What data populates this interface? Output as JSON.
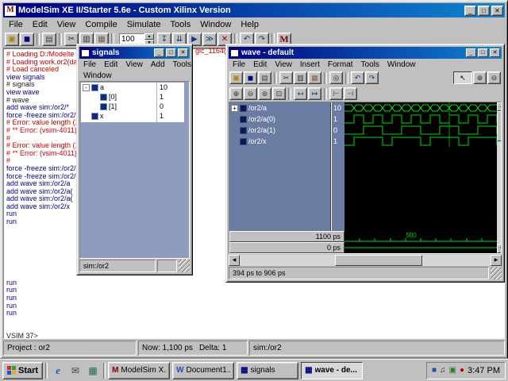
{
  "colors": {
    "title_gradient_start": "#000080",
    "title_gradient_end": "#1084d0",
    "error_text": "#cc0000",
    "command_text": "#00008b",
    "trace_green": "#00dd00",
    "signals_pane_slate": "#8e9cc0",
    "wave_names_bg": "#6b7ca2",
    "wave_bg": "#000000"
  },
  "window_controls": {
    "min": "_",
    "max": "□",
    "close": "✕"
  },
  "scrollbar": {
    "up": "▲",
    "down": "▼",
    "left": "◀",
    "right": "▶"
  },
  "main_window": {
    "title": "ModelSim XE II/Starter 5.6e - Custom Xilinx Version",
    "icon_letter": "M",
    "menu": [
      "File",
      "Edit",
      "View",
      "Compile",
      "Simulate",
      "Tools",
      "Window",
      "Help"
    ],
    "toolbar_left": [
      {
        "glyph": "▣",
        "color": "#b08000",
        "name": "open-icon"
      },
      {
        "glyph": "◼",
        "color": "#000080",
        "name": "save-icon"
      },
      {
        "cls": "sep",
        "inter": false
      },
      {
        "glyph": "▤",
        "color": "#404040",
        "name": "print-icon"
      },
      {
        "cls": "sep",
        "inter": false
      },
      {
        "glyph": "✂",
        "color": "#303030",
        "name": "cut-icon"
      },
      {
        "glyph": "▥",
        "color": "#303030",
        "name": "copy-icon"
      },
      {
        "glyph": "▦",
        "color": "#806040",
        "name": "paste-icon"
      },
      {
        "cls": "sep",
        "inter": false
      }
    ],
    "run_length": "100",
    "spin_up": "▲",
    "spin_down": "▼",
    "toolbar_right": [
      {
        "glyph": "↧",
        "color": "#004080",
        "name": "step-icon"
      },
      {
        "glyph": "⇊",
        "color": "#004080",
        "name": "step-over-icon"
      },
      {
        "glyph": "▶",
        "color": "#004080",
        "name": "run-icon"
      },
      {
        "glyph": "≫",
        "color": "#004080",
        "name": "continue-run-icon"
      },
      {
        "glyph": "✕",
        "color": "#a00000",
        "name": "break-icon"
      },
      {
        "cls": "sep",
        "inter": false
      },
      {
        "glyph": "↶",
        "color": "#004080",
        "name": "undo-icon"
      },
      {
        "glyph": "↷",
        "color": "#004080",
        "name": "redo-icon"
      },
      {
        "cls": "sep",
        "inter": false
      },
      {
        "glyph": "M",
        "color": "#800000",
        "name": "modelsim-logo-icon",
        "cls": "logo"
      }
    ],
    "status": {
      "project": "Project : or2",
      "now": "Now: 1,100 ps",
      "delta": "Delta: 1",
      "context": "sim:/or2"
    }
  },
  "transcript": {
    "overflow_fragment": "gic_1164(b",
    "lines": [
      {
        "t": "# Loading D:/Modelte",
        "cls": "c-red"
      },
      {
        "t": "# Loading work.or2(da",
        "cls": "c-red"
      },
      {
        "t": "# Load canceled",
        "cls": "c-red"
      },
      {
        "t": "view signals",
        "cls": "c-blue"
      },
      {
        "t": "# signals",
        "cls": "c-blk"
      },
      {
        "t": "view wave",
        "cls": "c-blue"
      },
      {
        "t": "# wave",
        "cls": "c-blk"
      },
      {
        "t": "add wave sim:/or2/*",
        "cls": "c-blue"
      },
      {
        "t": "force -freeze sim:/or2/*",
        "cls": "c-blue"
      },
      {
        "t": "# Error: value length (1",
        "cls": "c-red"
      },
      {
        "t": "# ** Error: (vsim-4011)",
        "cls": "c-red"
      },
      {
        "t": "#",
        "cls": "c-red"
      },
      {
        "t": "# Error: value length (1",
        "cls": "c-red"
      },
      {
        "t": "# ** Error: (vsim-4011)",
        "cls": "c-red"
      },
      {
        "t": "#",
        "cls": "c-red"
      },
      {
        "t": "force -freeze sim:/or2/",
        "cls": "c-blue"
      },
      {
        "t": "force -freeze sim:/or2/",
        "cls": "c-blue"
      },
      {
        "t": "add wave sim:/or2/a",
        "cls": "c-blue"
      },
      {
        "t": "add wave sim:/or2/a(",
        "cls": "c-blue"
      },
      {
        "t": "add wave sim:/or2/a(",
        "cls": "c-blue"
      },
      {
        "t": "add wave sim:/or2/x",
        "cls": "c-blue"
      },
      {
        "t": "run",
        "cls": "c-blue"
      },
      {
        "t": "run",
        "cls": "c-blue"
      },
      {
        "t": "",
        "cls": "c-blk"
      },
      {
        "t": "",
        "cls": "c-blk"
      },
      {
        "t": "",
        "cls": "c-blk"
      },
      {
        "t": "",
        "cls": "c-blk"
      },
      {
        "t": "",
        "cls": "c-blk"
      },
      {
        "t": "",
        "cls": "c-blk"
      },
      {
        "t": "",
        "cls": "c-blk"
      },
      {
        "t": "run",
        "cls": "c-blue"
      },
      {
        "t": "run",
        "cls": "c-blue"
      },
      {
        "t": "run",
        "cls": "c-blue"
      },
      {
        "t": "run",
        "cls": "c-blue"
      },
      {
        "t": "run",
        "cls": "c-blue"
      },
      {
        "t": "",
        "cls": "c-blk"
      },
      {
        "t": "",
        "cls": "c-blk"
      },
      {
        "t": "VSIM 37>",
        "cls": "c-blk"
      }
    ]
  },
  "signals_window": {
    "title": "signals",
    "menu_row1": [
      "File",
      "Edit",
      "View",
      "Add",
      "Tools"
    ],
    "menu_row2": [
      "Window"
    ],
    "rows": [
      {
        "prefix": "-",
        "name": "a",
        "value": "10"
      },
      {
        "prefix": "",
        "name": "[0]",
        "value": "1",
        "cls": "child"
      },
      {
        "prefix": "",
        "name": "[1]",
        "value": "0",
        "cls": "child"
      },
      {
        "prefix": "",
        "name": "x",
        "value": "1"
      }
    ],
    "status": "sim:/or2"
  },
  "wave_window": {
    "title": "wave - default",
    "menu": [
      "File",
      "Edit",
      "View",
      "Insert",
      "Format",
      "Tools",
      "Window"
    ],
    "toolbar1": [
      {
        "glyph": "▣",
        "color": "#b08000",
        "name": "open-icon"
      },
      {
        "glyph": "◼",
        "color": "#000080",
        "name": "save-icon"
      },
      {
        "glyph": "▤",
        "color": "#404040",
        "name": "print-icon"
      },
      {
        "cls": "sep",
        "inter": false
      },
      {
        "glyph": "✂",
        "color": "#303030",
        "name": "cut-icon"
      },
      {
        "glyph": "▥",
        "color": "#303030",
        "name": "copy-icon"
      },
      {
        "glyph": "▦",
        "color": "#806040",
        "name": "paste-icon"
      },
      {
        "cls": "sep",
        "inter": false
      },
      {
        "glyph": "◎",
        "color": "#303030",
        "name": "find-icon"
      },
      {
        "cls": "sep",
        "inter": false
      },
      {
        "glyph": "↶",
        "color": "#004080",
        "name": "undo-icon"
      },
      {
        "glyph": "↷",
        "color": "#004080",
        "name": "redo-icon"
      },
      {
        "cls": "spacer",
        "inter": false
      },
      {
        "glyph": "↖",
        "color": "#000000",
        "name": "select-cursor-icon",
        "cls": "cursorbtn"
      },
      {
        "glyph": "⊕",
        "color": "#303030",
        "name": "zoom-in-icon"
      },
      {
        "glyph": "⊖",
        "color": "#303030",
        "name": "zoom-out-icon"
      }
    ],
    "toolbar2": [
      {
        "glyph": "⊕",
        "color": "#303030",
        "name": "zoom-in-2x-icon"
      },
      {
        "glyph": "⊖",
        "color": "#303030",
        "name": "zoom-out-2x-icon"
      },
      {
        "glyph": "⊚",
        "color": "#303030",
        "name": "zoom-full-icon"
      },
      {
        "glyph": "⊡",
        "color": "#303030",
        "name": "zoom-range-icon"
      },
      {
        "cls": "sep",
        "inter": false
      },
      {
        "glyph": "↤",
        "color": "#004080",
        "name": "prev-transition-icon"
      },
      {
        "glyph": "↦",
        "color": "#004080",
        "name": "next-transition-icon"
      },
      {
        "cls": "sep",
        "inter": false
      },
      {
        "glyph": "⊢",
        "color": "#404040",
        "name": "expand-left-icon"
      },
      {
        "glyph": "⊣",
        "color": "#404040",
        "name": "expand-right-icon"
      }
    ],
    "signals": [
      {
        "prefix": "+",
        "name": "/or2/a",
        "value": "10"
      },
      {
        "prefix": "",
        "name": "/or2/a(0)",
        "value": "1"
      },
      {
        "prefix": "",
        "name": "/or2/a(1)",
        "value": "0"
      },
      {
        "prefix": "",
        "name": "/or2/x",
        "value": "1"
      }
    ],
    "timeline": {
      "now": "1100 ps",
      "cursor": "0 ps",
      "tick_label": "500"
    },
    "status": "394 ps to 906 ps"
  },
  "taskbar": {
    "start_label": "Start",
    "quick_launch": [
      {
        "glyph": "e",
        "color": "#1060c0",
        "name": "ie-icon",
        "cls": "ie"
      },
      {
        "glyph": "✉",
        "color": "#404060",
        "name": "outlook-icon"
      },
      {
        "glyph": "▦",
        "color": "#207050",
        "name": "show-desktop-icon"
      }
    ],
    "buttons": [
      {
        "label": "ModelSim X...",
        "glyph": "M",
        "color": "#800000",
        "name": "task-modelsim"
      },
      {
        "label": "Document1...",
        "glyph": "W",
        "color": "#2050c0",
        "name": "task-document1"
      },
      {
        "label": "signals",
        "glyph": "▦",
        "color": "#000080",
        "name": "task-signals"
      },
      {
        "label": "wave - de...",
        "glyph": "▦",
        "color": "#000080",
        "cls": "active",
        "name": "task-wave"
      }
    ],
    "tray_icons": [
      {
        "glyph": "■",
        "color": "#2050a0",
        "name": "tray-app-icon"
      },
      {
        "glyph": "♫",
        "color": "#303030",
        "name": "volume-icon"
      },
      {
        "glyph": "▣",
        "color": "#208020",
        "name": "display-settings-icon"
      },
      {
        "glyph": "●",
        "color": "#c00000",
        "name": "tray-status-icon"
      }
    ],
    "clock": "3:47 PM"
  }
}
